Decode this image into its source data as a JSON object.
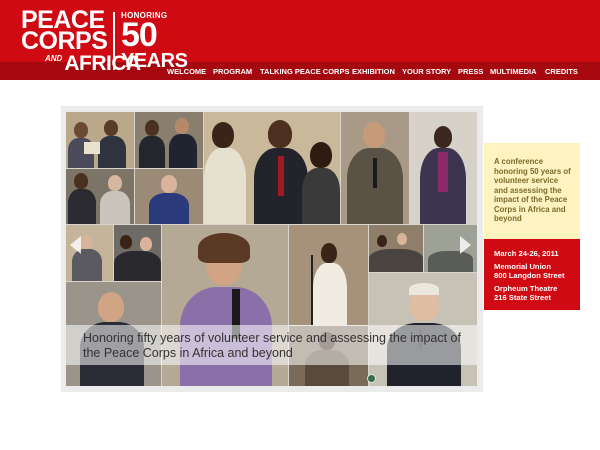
{
  "logo": {
    "line1": "PEACE",
    "line2": "CORPS",
    "and": "AND",
    "africa": "AFRICA",
    "honoring": "HONORING",
    "fifty": "50",
    "years": "YEARS"
  },
  "nav": {
    "items": [
      "WELCOME",
      "PROGRAM",
      "TALKING PEACE CORPS",
      "EXHIBITION",
      "YOUR STORY",
      "PRESS",
      "MULTIMEDIA",
      "CREDITS"
    ]
  },
  "hero": {
    "caption": "Honoring fifty years of volunteer service and assessing the impact of the Peace Corps in Africa and beyond"
  },
  "sidebar": {
    "about": "A conference honoring 50 years of volunteer service and assessing the impact of the Peace Corps in Africa and beyond",
    "dates": "March 24-26, 2011",
    "venue1_name": "Memorial Union",
    "venue1_address": "800 Langdon Street",
    "venue2_name": "Orpheum Theatre",
    "venue2_address": "216 State Street"
  },
  "colors": {
    "brand_red": "#cf0a12",
    "nav_band": "#a5080e",
    "sidebar_yellow": "#fff3c2"
  }
}
